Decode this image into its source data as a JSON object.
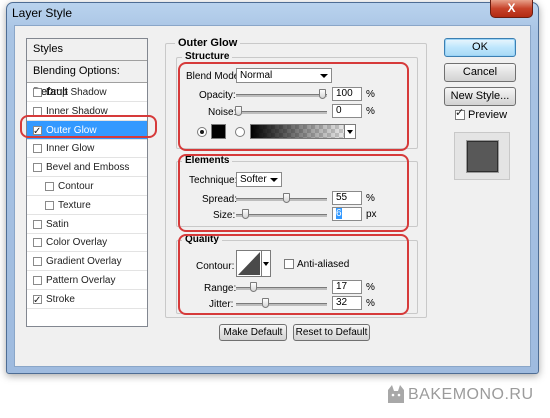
{
  "window": {
    "title": "Layer Style",
    "close_glyph": "X"
  },
  "styles_list": {
    "header": "Styles",
    "blending": "Blending Options: Default",
    "items": [
      {
        "label": "Drop Shadow",
        "checked": false
      },
      {
        "label": "Inner Shadow",
        "checked": false
      },
      {
        "label": "Outer Glow",
        "checked": true,
        "selected": true
      },
      {
        "label": "Inner Glow",
        "checked": false
      },
      {
        "label": "Bevel and Emboss",
        "checked": false
      },
      {
        "label": "Contour",
        "checked": false
      },
      {
        "label": "Texture",
        "checked": false
      },
      {
        "label": "Satin",
        "checked": false
      },
      {
        "label": "Color Overlay",
        "checked": false
      },
      {
        "label": "Gradient Overlay",
        "checked": false
      },
      {
        "label": "Pattern Overlay",
        "checked": false
      },
      {
        "label": "Stroke",
        "checked": true
      }
    ]
  },
  "panel": {
    "title": "Outer Glow",
    "structure": {
      "title": "Structure",
      "blend_mode_label": "Blend Mode:",
      "blend_mode": "Normal",
      "opacity_label": "Opacity:",
      "opacity": "100",
      "opacity_unit": "%",
      "noise_label": "Noise:",
      "noise": "0",
      "noise_unit": "%",
      "color": "#000000"
    },
    "elements": {
      "title": "Elements",
      "technique_label": "Technique:",
      "technique": "Softer",
      "spread_label": "Spread:",
      "spread": "55",
      "spread_unit": "%",
      "size_label": "Size:",
      "size": "6",
      "size_unit": "px"
    },
    "quality": {
      "title": "Quality",
      "contour_label": "Contour:",
      "anti_aliased_label": "Anti-aliased",
      "range_label": "Range:",
      "range": "17",
      "range_unit": "%",
      "jitter_label": "Jitter:",
      "jitter": "32",
      "jitter_unit": "%"
    },
    "make_default": "Make Default",
    "reset_to_default": "Reset to Default"
  },
  "side_buttons": {
    "ok": "OK",
    "cancel": "Cancel",
    "new_style": "New Style...",
    "preview_label": "Preview"
  },
  "watermark": "BAKEMONO.RU",
  "colors": {
    "accent_selected": "#3399ff",
    "highlight_frame": "#d63a3a",
    "preview_swatch": "#585858"
  }
}
